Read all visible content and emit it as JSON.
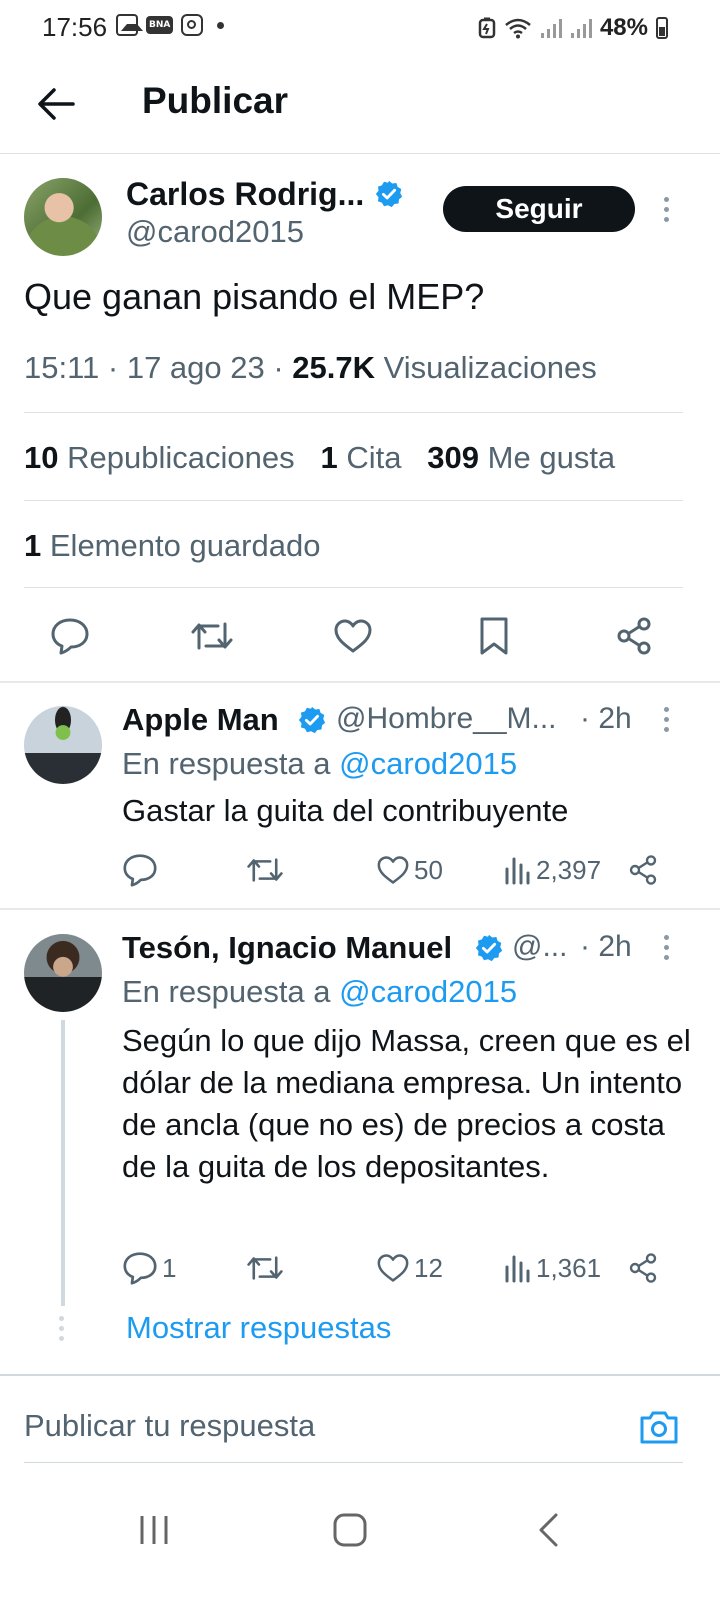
{
  "status_bar": {
    "time": "17:56",
    "bna_label": "BNA",
    "battery": "48%",
    "icons": [
      "gallery-icon",
      "bna-icon",
      "instagram-icon",
      "notification-dot",
      "battery-saver-icon",
      "wifi-icon",
      "signal-icon",
      "signal-icon",
      "battery-icon"
    ]
  },
  "header": {
    "title": "Publicar",
    "back_icon": "arrow-left-icon"
  },
  "tweet": {
    "author_name": "Carlos  Rodrig...",
    "author_handle": "@carod2015",
    "follow_label": "Seguir",
    "text": "Que ganan pisando el MEP?",
    "meta_time": "15:11 · 17 ago 23 · ",
    "views_count": "25.7K",
    "views_label": "Visualizaciones",
    "reposts_count": "10",
    "reposts_label": "Republicaciones",
    "quotes_count": "1",
    "quotes_label": "Cita",
    "likes_count": "309",
    "likes_label": "Me gusta",
    "bookmarks_count": "1",
    "bookmarks_label": "Elemento guardado",
    "action_icons": [
      "reply-icon",
      "repost-icon",
      "like-icon",
      "bookmark-icon",
      "share-icon"
    ]
  },
  "replies": [
    {
      "name": "Apple Man",
      "handle": "@Hombre__M...",
      "time": "· 2h",
      "reply_prefix": "En respuesta a",
      "reply_to": "@carod2015",
      "text": "Gastar la guita del contribuyente",
      "reply_count": "",
      "like_count": "50",
      "views_count": "2,397"
    },
    {
      "name": "Tesón, Ignacio Manuel",
      "handle": "@...",
      "time": "· 2h",
      "reply_prefix": "En respuesta a",
      "reply_to": "@carod2015",
      "text": "Según lo que dijo Massa, creen que es el dólar de la mediana empresa. Un intento de ancla (que no es) de precios a costa de la guita de los depositantes.",
      "reply_count": "1",
      "like_count": "12",
      "views_count": "1,361"
    }
  ],
  "show_replies_label": "Mostrar respuestas",
  "compose": {
    "placeholder": "Publicar tu respuesta"
  },
  "colors": {
    "accent": "#1d9bf0",
    "text_primary": "#0f1419",
    "text_secondary": "#536471",
    "border": "#dbe1e5",
    "follow_bg": "#0f1419"
  }
}
